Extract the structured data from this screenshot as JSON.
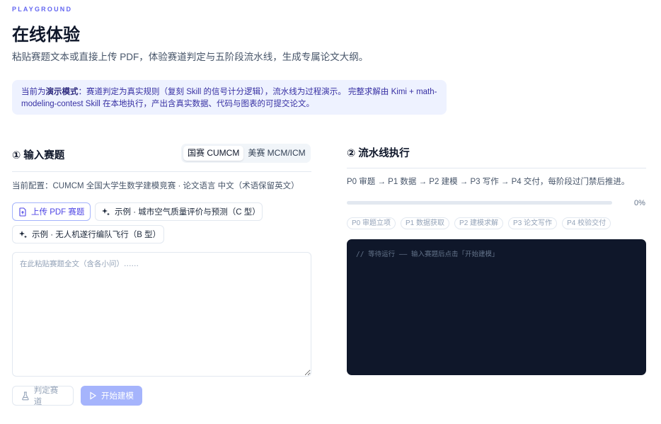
{
  "header": {
    "eyebrow": "PLAYGROUND",
    "title": "在线体验",
    "subtitle": "粘贴赛题文本或直接上传 PDF，体验赛道判定与五阶段流水线，生成专属论文大纲。"
  },
  "notice": {
    "prefix": "当前为",
    "bold": "演示模式",
    "body": "：赛道判定为真实规则（复刻 Skill 的信号计分逻辑），流水线为过程演示。 完整求解由 Kimi + math-modeling-contest Skill 在本地执行，产出含真实数据、代码与图表的可提交论文。"
  },
  "input_panel": {
    "title": "① 输入赛题",
    "contest_tabs": [
      {
        "label": "国赛 CUMCM",
        "active": true
      },
      {
        "label": "美赛 MCM/ICM",
        "active": false
      }
    ],
    "config": "当前配置：CUMCM 全国大学生数学建模竞赛 · 论文语言 中文（术语保留英文）",
    "upload_label": "上传 PDF 赛题",
    "example_1": "示例 · 城市空气质量评价与预测（C 型）",
    "example_2": "示例 · 无人机遂行编队飞行（B 型）",
    "textarea_placeholder": "在此粘贴赛题全文（含各小问）……",
    "judge_label": "判定赛道",
    "start_label": "开始建模"
  },
  "pipeline_panel": {
    "title": "② 流水线执行",
    "flow": "P0 审题 → P1 数据 → P2 建模 → P3 写作 → P4 交付，每阶段过门禁后推进。",
    "progress_percent": 0,
    "progress_label": "0%",
    "stages": [
      "P0 审题立项",
      "P1 数据获取",
      "P2 建模求解",
      "P3 论文写作",
      "P4 校验交付"
    ],
    "console_text": "// 等待运行 —— 输入赛题后点击「开始建模」"
  },
  "colors": {
    "accent": "#6366f1",
    "accent_soft": "#a5b4fc",
    "notice_bg": "#eef2ff",
    "console_bg": "#0f172a"
  }
}
